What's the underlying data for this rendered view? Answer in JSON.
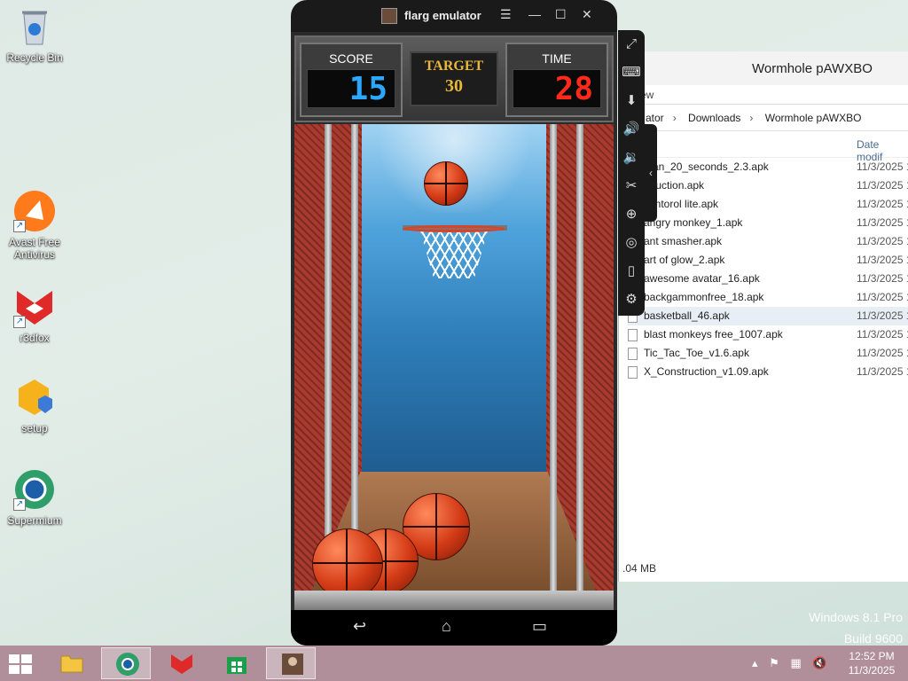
{
  "desktop": {
    "icons": [
      {
        "label": "Recycle Bin"
      },
      {
        "label": "Avast Free Antivirus"
      },
      {
        "label": "r3dfox"
      },
      {
        "label": "setup"
      },
      {
        "label": "Supermium"
      }
    ]
  },
  "emulator": {
    "title": "flarg emulator",
    "game": {
      "score_label": "SCORE",
      "score": "15",
      "target_label": "TARGET",
      "target": "30",
      "time_label": "TIME",
      "time": "28"
    }
  },
  "explorer": {
    "title": "Wormhole pAWXBO",
    "menu_fragment": "ew",
    "breadcrumb": [
      "ator",
      "Downloads",
      "Wormhole pAWXBO"
    ],
    "column_date": "Date modif",
    "files": [
      {
        "name": "man_20_seconds_2.3.apk",
        "date": "11/3/2025 1"
      },
      {
        "name": "oduction.apk",
        "date": "11/3/2025 1"
      },
      {
        "name": "contorol lite.apk",
        "date": "11/3/2025 1"
      },
      {
        "name": "angry monkey_1.apk",
        "date": "11/3/2025 1"
      },
      {
        "name": "ant smasher.apk",
        "date": "11/3/2025 1"
      },
      {
        "name": "art of glow_2.apk",
        "date": "11/3/2025 1"
      },
      {
        "name": "awesome avatar_16.apk",
        "date": "11/3/2025 1"
      },
      {
        "name": "backgammonfree_18.apk",
        "date": "11/3/2025 1"
      },
      {
        "name": "basketball_46.apk",
        "date": "11/3/2025 1"
      },
      {
        "name": "blast monkeys free_1007.apk",
        "date": "11/3/2025 1"
      },
      {
        "name": "Tic_Tac_Toe_v1.6.apk",
        "date": "11/3/2025 1"
      },
      {
        "name": "X_Construction_v1.09.apk",
        "date": "11/3/2025 1"
      }
    ],
    "status": ".04 MB"
  },
  "watermark": {
    "line1": "Windows 8.1 Pro",
    "line2": "Build 9600"
  },
  "taskbar": {
    "time": "12:52 PM",
    "date": "11/3/2025"
  },
  "colors": {
    "score": "#2aa8ff",
    "time": "#ff2a1a",
    "target": "#e8b73a",
    "taskbar": "#b08e9a"
  }
}
